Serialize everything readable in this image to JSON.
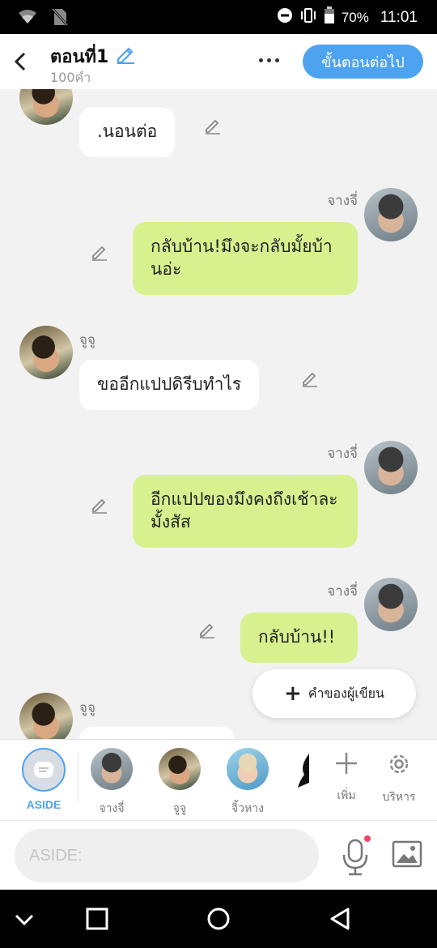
{
  "status_bar": {
    "battery": "70%",
    "time": "11:01"
  },
  "header": {
    "title": "ตอนที่1",
    "word_count": "100คำ",
    "next_button": "ขั้นตอนต่อไป"
  },
  "messages": [
    {
      "speaker": "",
      "text": ".นอนต่อ",
      "side": "left"
    },
    {
      "speaker": "จางจี่",
      "text": "กลับบ้าน!มึงจะกลับมั้ยบ้านอ่ะ",
      "side": "right"
    },
    {
      "speaker": "จูจู",
      "text": "ขออีกแปปดิรีบทำไร",
      "side": "left"
    },
    {
      "speaker": "จางจี่",
      "text": "อีกแปปของมึงคงถึงเช้าละมั้งสัส",
      "side": "right"
    },
    {
      "speaker": "จางจี่",
      "text": "กลับบ้าน!!",
      "side": "right"
    },
    {
      "speaker": "จูจู",
      "text": "",
      "side": "left"
    }
  ],
  "author_note_button": "คำของผู้เขียน",
  "tray": {
    "aside_label": "ASIDE",
    "characters": [
      {
        "name": "จางจี่"
      },
      {
        "name": "จูจู"
      },
      {
        "name": "จิ้วหาง"
      }
    ],
    "add_label": "เพิ่ม",
    "manage_label": "บริหาร"
  },
  "input": {
    "placeholder": "ASIDE:"
  },
  "colors": {
    "accent": "#4da3f0",
    "my_bubble": "#d7f18f",
    "other_bubble": "#ffffff",
    "background": "#f2f2f2"
  }
}
